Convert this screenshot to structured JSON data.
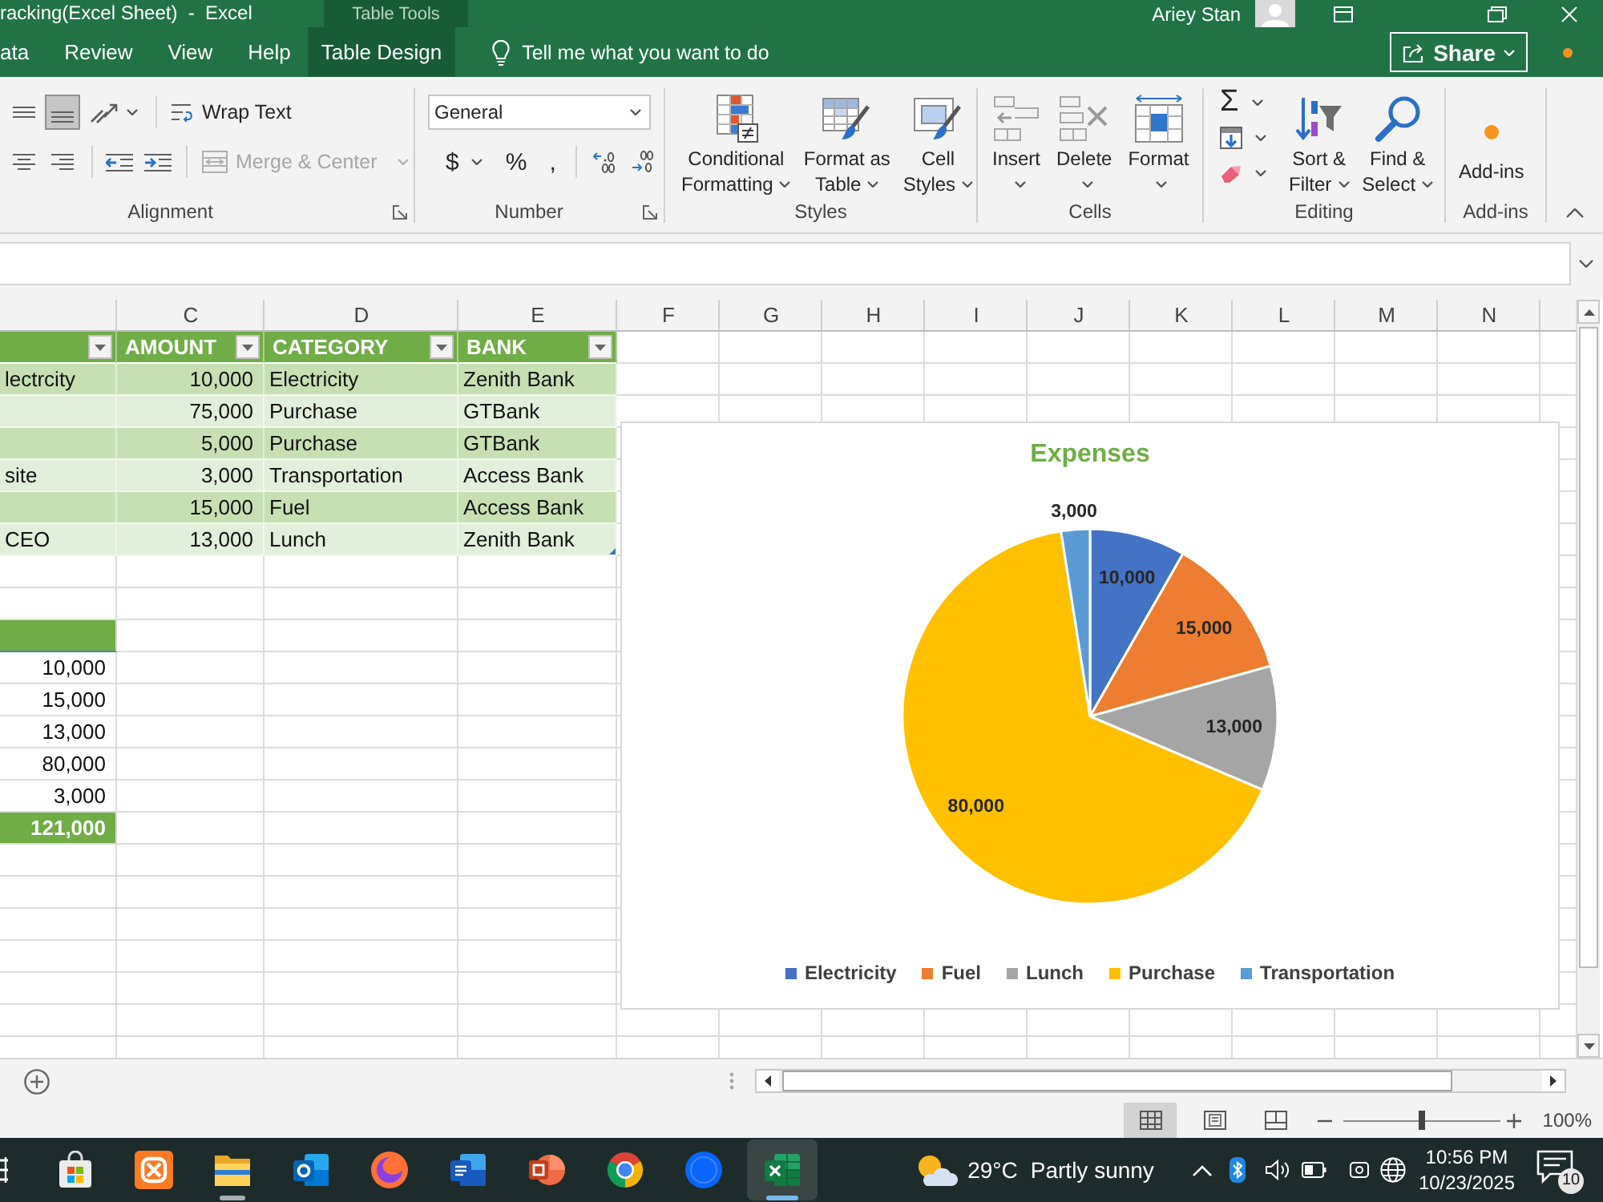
{
  "title_bar": {
    "title": "racking(Excel Sheet)  -  Excel",
    "context_label": "Table Tools",
    "user": "Ariey Stan"
  },
  "tabs": [
    {
      "label": "ata",
      "contextual": false
    },
    {
      "label": "Review",
      "contextual": false
    },
    {
      "label": "View",
      "contextual": false
    },
    {
      "label": "Help",
      "contextual": false
    },
    {
      "label": "Table Design",
      "contextual": true
    }
  ],
  "tell_me": {
    "placeholder": "Tell me what you want to do"
  },
  "share_button": {
    "label": "Share"
  },
  "ribbon": {
    "alignment": {
      "label": "Alignment",
      "row_1": [
        {
          "kind": "middle-align",
          "selected": false
        },
        {
          "kind": "bottom-align",
          "selected": true
        },
        {
          "kind": "orientation",
          "selected": false
        }
      ],
      "row_2": [
        {
          "kind": "center",
          "selected": false
        },
        {
          "kind": "align-right",
          "selected": false
        },
        {
          "kind": "decrease-indent",
          "selected": false
        },
        {
          "kind": "increase-indent",
          "selected": false
        }
      ],
      "wrap_text": {
        "label": "Wrap Text"
      },
      "merge": {
        "label": "Merge & Center",
        "disabled": true
      }
    },
    "number": {
      "label": "Number",
      "format": {
        "value": "General"
      },
      "symbols": [
        "$",
        "%",
        ","
      ]
    },
    "styles": {
      "label": "Styles",
      "buttons": [
        {
          "kind": "conditional-formatting",
          "lines": [
            "Conditional",
            "Formatting"
          ],
          "menu": true
        },
        {
          "kind": "format-as-table",
          "lines": [
            "Format as",
            "Table"
          ],
          "menu": true
        },
        {
          "kind": "cell-styles",
          "lines": [
            "Cell",
            "Styles"
          ],
          "menu": true
        }
      ]
    },
    "cells": {
      "label": "Cells",
      "buttons": [
        {
          "kind": "insert",
          "lines": [
            "Insert"
          ],
          "menu": true
        },
        {
          "kind": "delete",
          "lines": [
            "Delete"
          ],
          "menu": true
        },
        {
          "kind": "format",
          "lines": [
            "Format"
          ],
          "menu": true
        }
      ]
    },
    "editing": {
      "label": "Editing",
      "autosum": "Σ",
      "buttons": [
        {
          "kind": "sort-filter",
          "lines": [
            "Sort &",
            "Filter"
          ],
          "menu": true
        },
        {
          "kind": "find-select",
          "lines": [
            "Find &",
            "Select"
          ],
          "menu": true
        }
      ]
    },
    "add_ins": {
      "label": "Add-ins",
      "buttons": [
        {
          "kind": "add-ins",
          "lines": [
            "Add-ins"
          ],
          "menu": false
        }
      ]
    }
  },
  "sheet": {
    "columns": [
      "C",
      "D",
      "E",
      "F",
      "G",
      "H",
      "I",
      "J",
      "K",
      "L",
      "M",
      "N"
    ],
    "table": {
      "headers": [
        "AMOUNT",
        "CATEGORY",
        "BANK"
      ],
      "rows": [
        {
          "column_1": "lectrcity",
          "amount": "10,000",
          "category": "Electricity",
          "bank": "Zenith Bank"
        },
        {
          "amount": "75,000",
          "category": "Purchase",
          "bank": "GTBank"
        },
        {
          "amount": "5,000",
          "category": "Purchase",
          "bank": "GTBank"
        },
        {
          "column_1": "site",
          "amount": "3,000",
          "category": "Transportation",
          "bank": "Access Bank"
        },
        {
          "amount": "15,000",
          "category": "Fuel",
          "bank": "Access Bank"
        },
        {
          "column_1": "CEO",
          "amount": "13,000",
          "category": "Lunch",
          "bank": "Zenith Bank"
        }
      ]
    },
    "summary": {
      "values": [
        "10,000",
        "15,000",
        "13,000",
        "80,000",
        "3,000"
      ],
      "total": "121,000"
    },
    "chart": {
      "chart_data": {
        "type": "pie",
        "title": "Expenses",
        "categories": [
          "Electricity",
          "Fuel",
          "Lunch",
          "Purchase",
          "Transportation"
        ],
        "values": [
          10000,
          15000,
          13000,
          80000,
          3000
        ],
        "colors": [
          "#4472c4",
          "#ed7d31",
          "#a5a5a5",
          "#ffc000",
          "#5b9bd5"
        ],
        "value_labels": [
          "10,000",
          "15,000",
          "13,000",
          "80,000",
          "3,000"
        ],
        "legend": "bottom"
      }
    }
  },
  "status_bar": {
    "views": [
      {
        "kind": "normal",
        "selected": true
      },
      {
        "kind": "page-layout",
        "selected": false
      },
      {
        "kind": "page-break",
        "selected": false
      }
    ],
    "zoom": {
      "level": 0.5,
      "reading": "100%"
    }
  },
  "taskbar": {
    "apps": [
      {
        "kind": "edge",
        "selected": false,
        "open": false
      },
      {
        "kind": "bag",
        "selected": false,
        "open": false
      },
      {
        "kind": "tile",
        "selected": false,
        "open": false
      },
      {
        "kind": "folder",
        "selected": false,
        "open": true
      },
      {
        "kind": "mail",
        "selected": false,
        "open": false
      },
      {
        "kind": "fox",
        "selected": false,
        "open": false
      },
      {
        "kind": "document",
        "selected": false,
        "open": false
      },
      {
        "kind": "slides",
        "selected": false,
        "open": false
      },
      {
        "kind": "ring",
        "selected": false,
        "open": false
      },
      {
        "kind": "circle",
        "selected": false,
        "open": false
      },
      {
        "kind": "sheet",
        "selected": true,
        "open": true
      }
    ],
    "weather": {
      "temperature": "29°C",
      "condition": "Partly sunny"
    },
    "clock": {
      "time": "10:56 PM",
      "date": "10/23/2025"
    },
    "notifications": {
      "count": "10"
    }
  }
}
